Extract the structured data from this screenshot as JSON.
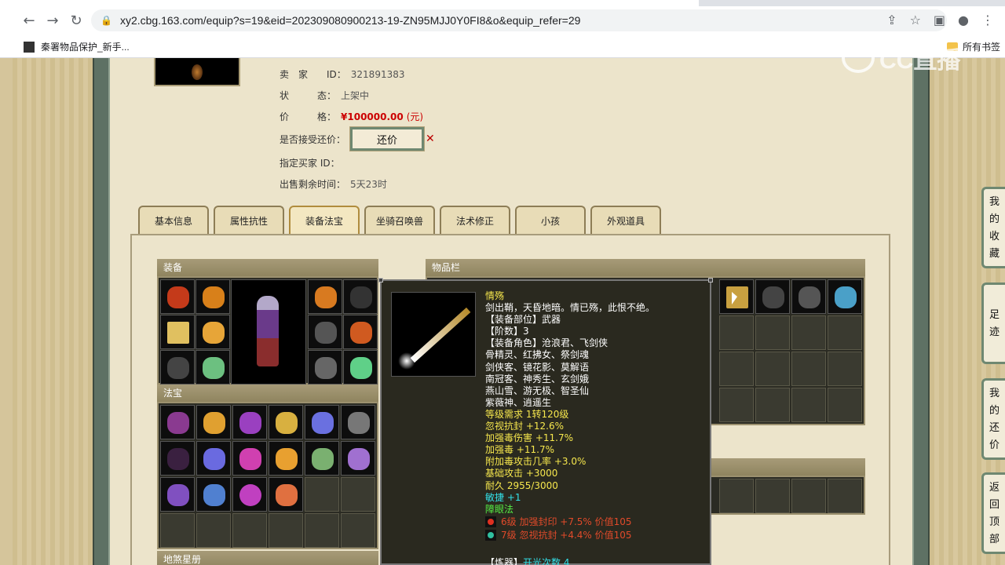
{
  "browser": {
    "url": "xy2.cbg.163.com/equip?s=19&eid=202309080900213-19-ZN95MJJ0Y0FI8&o&equip_refer=29",
    "bookmark": "秦署物品保护_新手...",
    "bookmark_right": "所有书签"
  },
  "watermark": "CC直播",
  "info": {
    "seller_label": "卖　家　　ID：",
    "seller_id": "321891383",
    "status_label": "状　　　态：",
    "status_value": "上架中",
    "price_label": "价　　　格：",
    "price_value": "¥100000.00",
    "price_unit": "(元)",
    "counter_label": "是否接受还价：",
    "counter_button": "还价",
    "buyer_label": "指定买家 ID：",
    "remain_label": "出售剩余时间：",
    "remain_value": "5天23时"
  },
  "tabs": [
    "基本信息",
    "属性抗性",
    "装备法宝",
    "坐骑召唤兽",
    "法术修正",
    "小孩",
    "外观道具"
  ],
  "active_tab": "装备法宝",
  "sections": {
    "equip": "装备",
    "fabao": "法宝",
    "items": "物品栏",
    "bottom": "地煞星册"
  },
  "tooltip": {
    "name": "情殇",
    "desc": "剑出鞘，天昏地暗。情已殇，此恨不绝。",
    "slot": "【装备部位】武器",
    "tier": "【阶数】3",
    "roles_title": "【装备角色】沧浪君、飞剑侠",
    "roles": [
      "骨精灵、红拂女、祭剑魂",
      "剑侠客、镜花影、莫解语",
      "南冠客、神秀生、玄剑娥",
      "燕山雪、游无极、智圣仙",
      "紫薇神、逍遥生"
    ],
    "req": "等级需求 1转120级",
    "stats": [
      "忽视抗封 +12.6%",
      "加强毒伤害 +11.7%",
      "加强毒 +11.7%",
      "附加毒攻击几率 +3.0%",
      "基础攻击 +3000",
      "耐久 2955/3000"
    ],
    "agility": "敏捷 +1",
    "skill": "障眼法",
    "gems": [
      "6级 加强封印 +7.5% 价值105",
      "7级 忽视抗封 +4.4% 价值105"
    ],
    "refine_label": "【炼器】",
    "refine_value": "开光次数 4"
  },
  "side_buttons": [
    "我的收藏",
    "足迹",
    "我的还价",
    "返回顶部"
  ]
}
